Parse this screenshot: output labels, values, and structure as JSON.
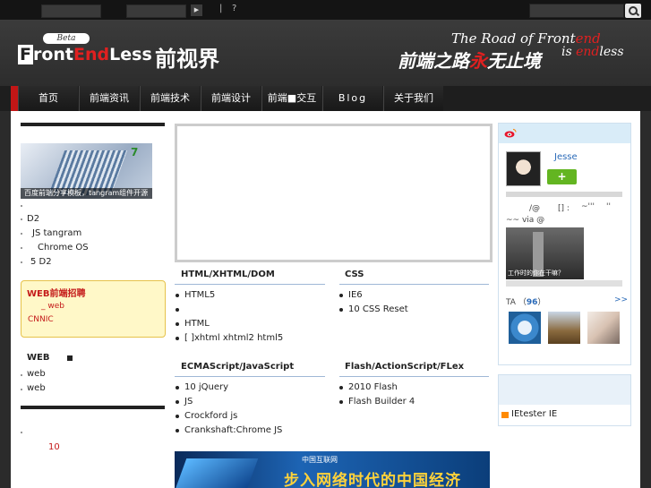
{
  "topbar": {
    "separator": "|",
    "question": "?",
    "play_symbol": "▶"
  },
  "header": {
    "beta": "Beta",
    "logo_f": "F",
    "logo_ront": "ront",
    "logo_end": "End",
    "logo_less": "Less",
    "logo_cn": "前视界",
    "slogan_prefix": "The Road of Front",
    "slogan_end": "end",
    "slogan2_prefix": "is ",
    "slogan2_end": "end",
    "slogan2_suffix": "less",
    "slogan_cn_a": "前端之路",
    "slogan_cn_red": "永",
    "slogan_cn_b": "无止境"
  },
  "nav": {
    "items": [
      "首页",
      "前端资讯",
      "前端技术",
      "前端设计",
      "前端■交互",
      "Blog",
      "关于我们"
    ]
  },
  "left": {
    "banner_caption": "百度前端分享模板，tangram组件开源",
    "list": [
      "D2",
      "JS  tangram",
      "Chrome OS",
      "5 D2"
    ],
    "jobs_title": "WEB前端招聘",
    "jobs_line1": "_ web",
    "jobs_line2": "CNNIC",
    "web_head": "WEB",
    "web_items": [
      "web",
      "web"
    ],
    "red_num": "10"
  },
  "main": {
    "sections": [
      {
        "title": "HTML/XHTML/DOM",
        "items": [
          "HTML5",
          "",
          "HTML",
          "[ ]xhtml xhtml2 html5"
        ]
      },
      {
        "title": "CSS",
        "items": [
          "IE6",
          "10     CSS Reset"
        ]
      },
      {
        "title": "ECMAScript/JavaScript",
        "items": [
          "10          jQuery",
          "JS",
          "Crockford js",
          "Crankshaft:Chrome   JS"
        ]
      },
      {
        "title": "Flash/ActionScript/FLex",
        "items": [
          "2010 Flash",
          "Flash Builder 4"
        ]
      }
    ],
    "ad_brand": "中国互联网",
    "ad_text": "步入网络时代的中国经济"
  },
  "profile": {
    "name": "Jesse",
    "follow": "+",
    "line1a": "/@",
    "line1b": "[] :",
    "line1c": "~'''",
    "line1d": "''",
    "line2": "~~ via @",
    "photo_caption": "工作时的你在干嘛？",
    "ta_label": "TA",
    "ta_count": "96",
    "more": ">>"
  },
  "iebox": {
    "text": "IEtester IE"
  }
}
